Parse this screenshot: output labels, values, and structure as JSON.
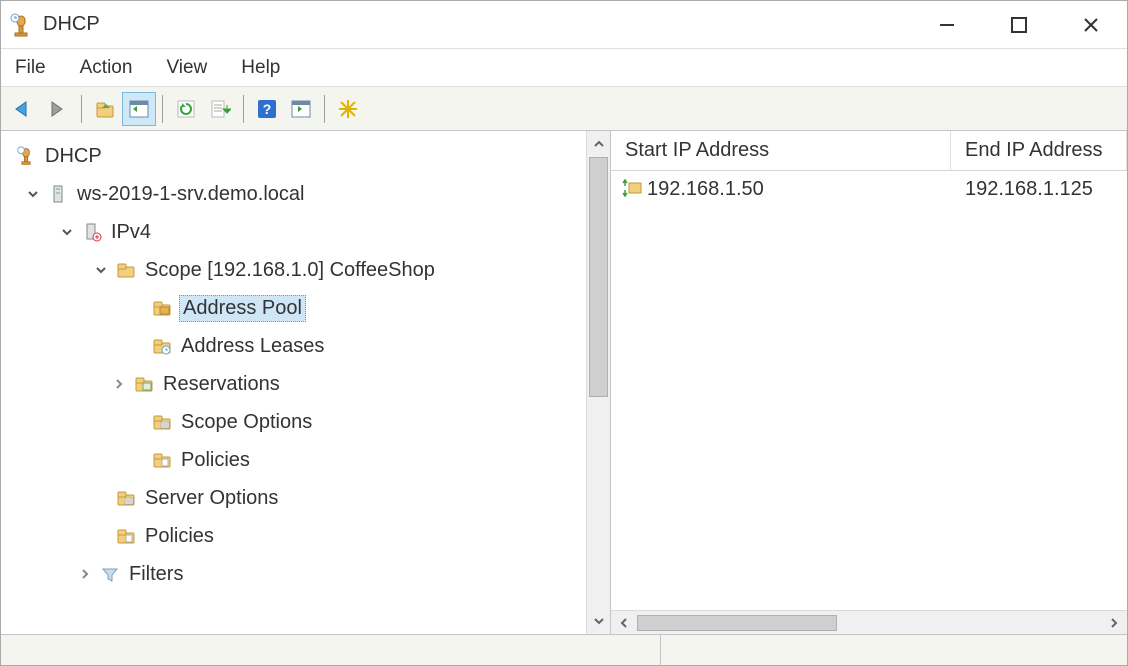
{
  "window": {
    "title": "DHCP"
  },
  "menu": {
    "file": "File",
    "action": "Action",
    "view": "View",
    "help": "Help"
  },
  "tree": {
    "root": "DHCP",
    "server": "ws-2019-1-srv.demo.local",
    "ipv4": "IPv4",
    "scope": "Scope [192.168.1.0] CoffeeShop",
    "addr_pool": "Address Pool",
    "addr_leases": "Address Leases",
    "reservations": "Reservations",
    "scope_opts": "Scope Options",
    "scope_policies": "Policies",
    "server_opts": "Server Options",
    "server_policies": "Policies",
    "filters": "Filters"
  },
  "list": {
    "col_start": "Start IP Address",
    "col_end": "End IP Address",
    "rows": [
      {
        "start": "192.168.1.50",
        "end": "192.168.1.125"
      }
    ]
  }
}
